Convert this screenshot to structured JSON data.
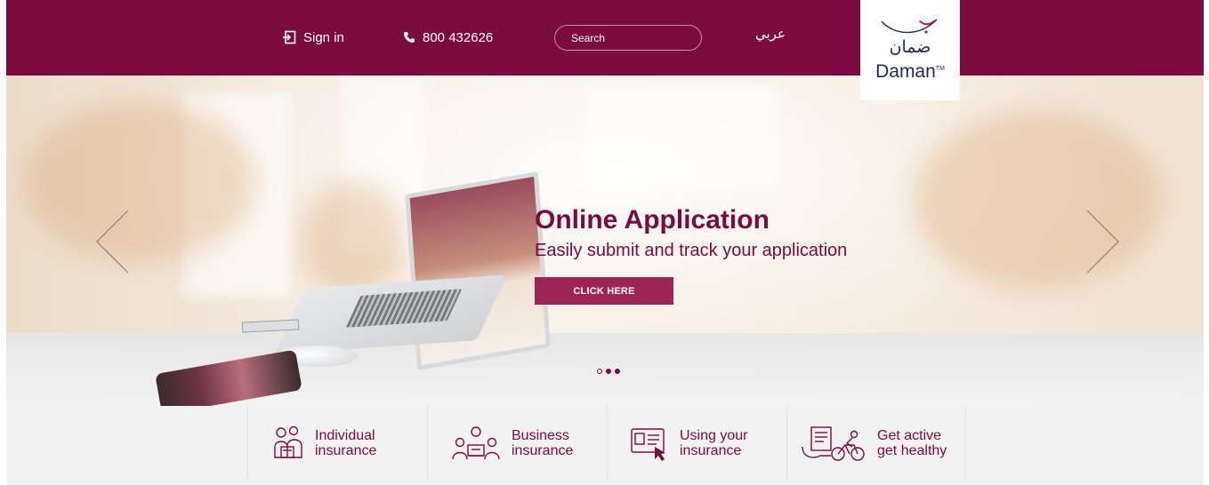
{
  "header": {
    "sign_in": "Sign in",
    "phone": "800 432626",
    "search_placeholder": "Search",
    "arabic_link": "عربي",
    "logo_arabic": "ضمان",
    "logo_english": "Daman",
    "logo_tm": "TM",
    "background_color": "#7b0a3f"
  },
  "hero": {
    "title": "Online Application",
    "subtitle": "Easily submit and track your application",
    "cta_label": "CLICK HERE",
    "accent_color": "#7b0a3f",
    "cta_color": "#9c2456",
    "slide_count": 3,
    "active_slide": 1
  },
  "categories": [
    {
      "line1": "Individual",
      "line2": "insurance",
      "icon": "family-icon"
    },
    {
      "line1": "Business",
      "line2": "insurance",
      "icon": "team-meeting-icon"
    },
    {
      "line1": "Using your",
      "line2": "insurance",
      "icon": "insurance-card-icon"
    },
    {
      "line1": "Get active",
      "line2": "get healthy",
      "icon": "cycling-icon"
    }
  ]
}
